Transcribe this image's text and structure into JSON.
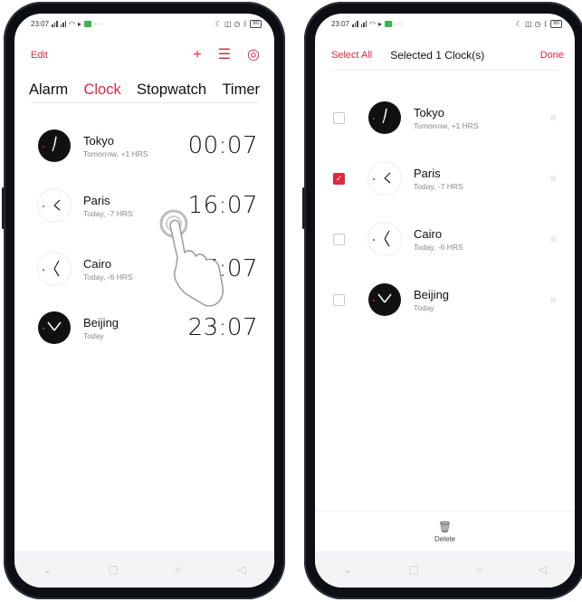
{
  "status_bar": {
    "left_time": "23:07",
    "right_time": "23:07",
    "battery": "80"
  },
  "left_screen": {
    "edit_label": "Edit",
    "add_icon": "plus-icon",
    "list_icon": "list-icon",
    "settings_icon": "settings-icon",
    "tabs": [
      {
        "label": "Alarm",
        "active": false
      },
      {
        "label": "Clock",
        "active": true
      },
      {
        "label": "Stopwatch",
        "active": false
      },
      {
        "label": "Timer",
        "active": false
      }
    ],
    "clocks": [
      {
        "city": "Tokyo",
        "subtitle": "Tomorrow, +1 HRS",
        "time": "00:07",
        "face": "dark"
      },
      {
        "city": "Paris",
        "subtitle": "Today, -7 HRS",
        "time": "16:07",
        "face": "light"
      },
      {
        "city": "Cairo",
        "subtitle": "Today, -6 HRS",
        "time": "17:07",
        "face": "light"
      },
      {
        "city": "Beijing",
        "subtitle": "Today",
        "time": "23:07",
        "face": "dark"
      }
    ]
  },
  "right_screen": {
    "select_all_label": "Select All",
    "selected_label": "Selected 1 Clock(s)",
    "done_label": "Done",
    "clocks": [
      {
        "city": "Tokyo",
        "subtitle": "Tomorrow, +1 HRS",
        "checked": false,
        "face": "dark"
      },
      {
        "city": "Paris",
        "subtitle": "Today, -7 HRS",
        "checked": true,
        "face": "light"
      },
      {
        "city": "Cairo",
        "subtitle": "Today, -6 HRS",
        "checked": false,
        "face": "light"
      },
      {
        "city": "Beijing",
        "subtitle": "Today",
        "checked": false,
        "face": "dark"
      }
    ],
    "delete_label": "Delete"
  },
  "colors": {
    "accent": "#e0283e",
    "frame": "#0d0f14"
  }
}
